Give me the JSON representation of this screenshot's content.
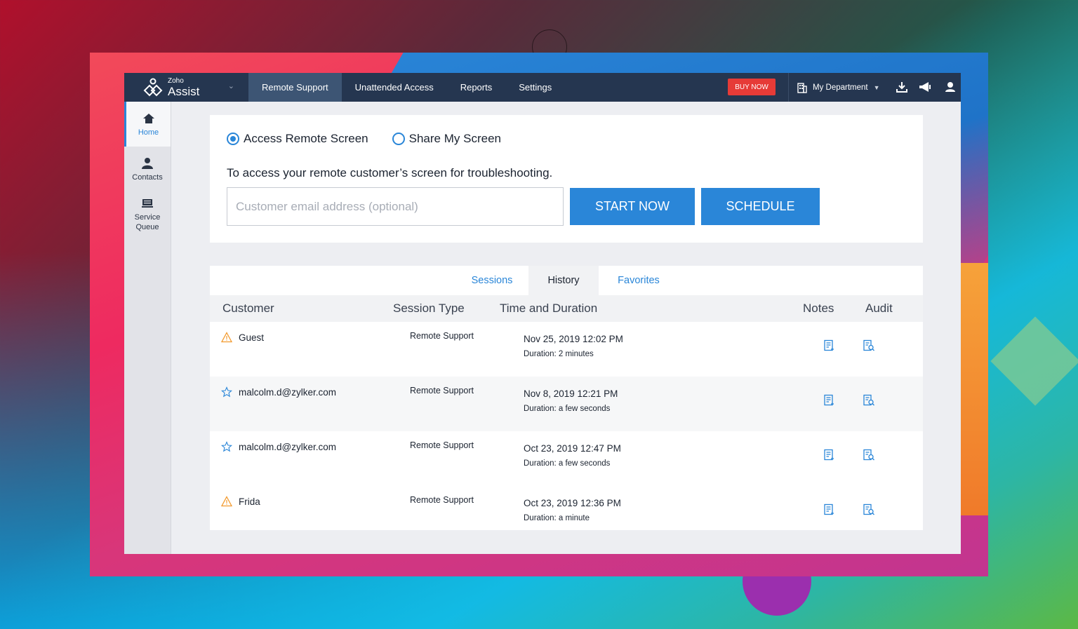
{
  "topbar": {
    "logo_small": "Zoho",
    "logo_big": "Assist",
    "nav": [
      "Remote Support",
      "Unattended Access",
      "Reports",
      "Settings"
    ],
    "buy_now": "BUY NOW",
    "department": "My Department"
  },
  "sidebar": {
    "items": [
      {
        "label": "Home",
        "icon": "home-icon"
      },
      {
        "label": "Contacts",
        "icon": "user-icon"
      },
      {
        "label": "Service Queue",
        "icon": "queue-icon"
      }
    ]
  },
  "connect": {
    "option_access": "Access Remote Screen",
    "option_share": "Share My Screen",
    "description": "To access your remote customer’s screen for troubleshooting.",
    "email_placeholder": "Customer email address (optional)",
    "start_label": "START NOW",
    "schedule_label": "SCHEDULE"
  },
  "tabs": {
    "sessions": "Sessions",
    "history": "History",
    "favorites": "Favorites"
  },
  "table": {
    "headers": {
      "customer": "Customer",
      "session_type": "Session Type",
      "time": "Time and Duration",
      "notes": "Notes",
      "audit": "Audit"
    },
    "rows": [
      {
        "customer": "Guest",
        "icon": "warning-icon",
        "type": "Remote Support",
        "time": "Nov 25, 2019 12:02 PM",
        "duration": "Duration: 2 minutes"
      },
      {
        "customer": "malcolm.d@zylker.com",
        "icon": "star-icon",
        "type": "Remote Support",
        "time": "Nov 8, 2019 12:21 PM",
        "duration": "Duration: a few seconds"
      },
      {
        "customer": "malcolm.d@zylker.com",
        "icon": "star-icon",
        "type": "Remote Support",
        "time": "Oct 23, 2019 12:47 PM",
        "duration": "Duration: a few seconds"
      },
      {
        "customer": "Frida",
        "icon": "warning-icon",
        "type": "Remote Support",
        "time": "Oct 23, 2019 12:36 PM",
        "duration": "Duration: a minute"
      }
    ]
  },
  "colors": {
    "accent": "#2a86d8",
    "topbar": "#253650",
    "buy_now": "#e63b37"
  }
}
